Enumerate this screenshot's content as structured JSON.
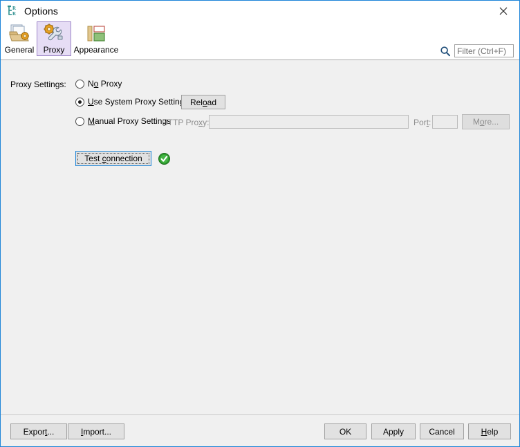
{
  "window": {
    "title": "Options",
    "app_icon": "repository-tree-icon",
    "close_label": "✕",
    "border_color": "#1b84d8"
  },
  "toolbar": {
    "tabs": [
      {
        "label": "General",
        "icon": "folder-gear-icon",
        "selected": false
      },
      {
        "label": "Proxy",
        "icon": "gear-wrench-icon",
        "selected": true
      },
      {
        "label": "Appearance",
        "icon": "layout-blocks-icon",
        "selected": false
      }
    ],
    "selected_tab": "Proxy",
    "selected_tab_bg": "#e6ddf5",
    "selected_tab_border": "#9b84c7",
    "filter": {
      "icon": "search-icon",
      "value": "",
      "placeholder": "Filter (Ctrl+F)"
    }
  },
  "main": {
    "section_label": "Proxy Settings:",
    "options": [
      {
        "id": "no-proxy",
        "label_pre": "N",
        "label_mnemonic": "o",
        "label_post": " Proxy",
        "checked": false
      },
      {
        "id": "use-system-proxy",
        "label_pre": "",
        "label_mnemonic": "U",
        "label_post": "se System Proxy Settings",
        "checked": true
      },
      {
        "id": "manual-proxy",
        "label_pre": "",
        "label_mnemonic": "M",
        "label_post": "anual Proxy Settings",
        "checked": false
      }
    ],
    "reload_button": {
      "pre": "Rel",
      "mnemonic": "o",
      "post": "ad",
      "enabled": true
    },
    "http_proxy": {
      "label_pre": "HTTP Pro",
      "label_mnemonic": "x",
      "label_post": "y:",
      "value": "",
      "placeholder": "",
      "enabled": false
    },
    "port": {
      "label_pre": "Por",
      "label_mnemonic": "t",
      "label_post": ":",
      "value": "",
      "placeholder": "",
      "enabled": false
    },
    "more_button": {
      "pre": "M",
      "mnemonic": "o",
      "post": "re...",
      "enabled": false
    },
    "test_connection": {
      "pre": "Test ",
      "mnemonic": "c",
      "post": "onnection",
      "focused": true
    },
    "status": {
      "icon": "success-check-icon",
      "color": "#2e9e2e",
      "state": "success"
    }
  },
  "footer": {
    "export": {
      "pre": "Expor",
      "mnemonic": "t",
      "post": "..."
    },
    "import": {
      "pre": "",
      "mnemonic": "I",
      "post": "mport..."
    },
    "ok": {
      "pre": "OK",
      "mnemonic": "",
      "post": ""
    },
    "apply": {
      "pre": "Apply",
      "mnemonic": "",
      "post": ""
    },
    "cancel": {
      "pre": "Cancel",
      "mnemonic": "",
      "post": ""
    },
    "help": {
      "pre": "",
      "mnemonic": "H",
      "post": "elp"
    }
  }
}
